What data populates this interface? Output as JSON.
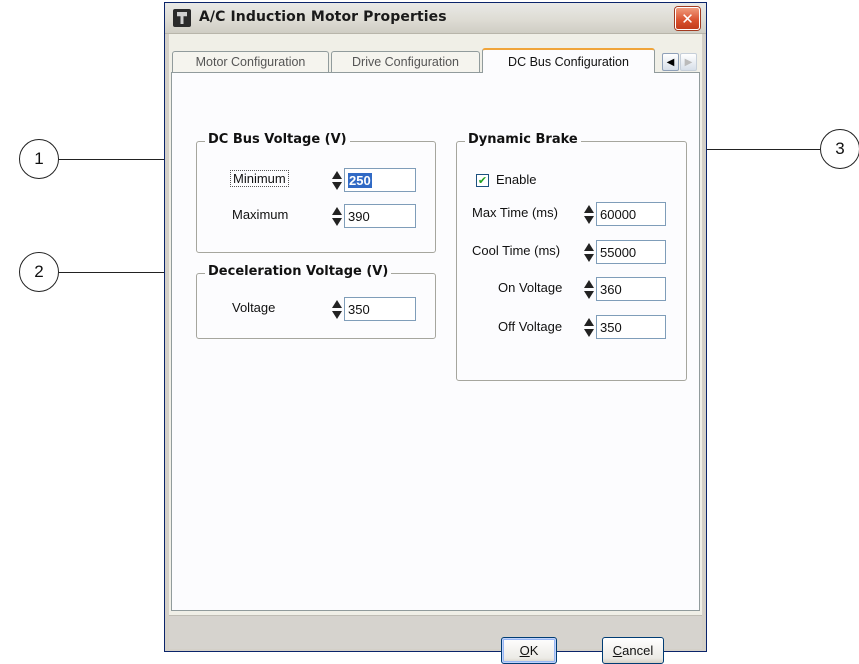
{
  "window": {
    "title": "A/C Induction Motor Properties",
    "close_glyph": "✕"
  },
  "tabs": [
    {
      "label": "Motor Configuration"
    },
    {
      "label": "Drive Configuration"
    },
    {
      "label": "DC Bus Configuration",
      "active": true
    }
  ],
  "tab_scroll": {
    "left": "◀",
    "right": "▶"
  },
  "dc_bus_voltage": {
    "title": "DC Bus Voltage (V)",
    "minimum_label": "Minimum",
    "minimum_value": "250",
    "maximum_label": "Maximum",
    "maximum_value": "390"
  },
  "deceleration_voltage": {
    "title": "Deceleration Voltage (V)",
    "voltage_label": "Voltage",
    "voltage_value": "350"
  },
  "dynamic_brake": {
    "title": "Dynamic Brake",
    "enable_label": "Enable",
    "enable_checked": true,
    "check_glyph": "✔",
    "max_time_label": "Max Time (ms)",
    "max_time_value": "60000",
    "cool_time_label": "Cool Time (ms)",
    "cool_time_value": "55000",
    "on_voltage_label": "On Voltage",
    "on_voltage_value": "360",
    "off_voltage_label": "Off Voltage",
    "off_voltage_value": "350"
  },
  "buttons": {
    "ok_mnemonic": "O",
    "ok_rest": "K",
    "cancel_mnemonic": "C",
    "cancel_rest": "ancel"
  },
  "callouts": [
    "1",
    "2",
    "3"
  ]
}
